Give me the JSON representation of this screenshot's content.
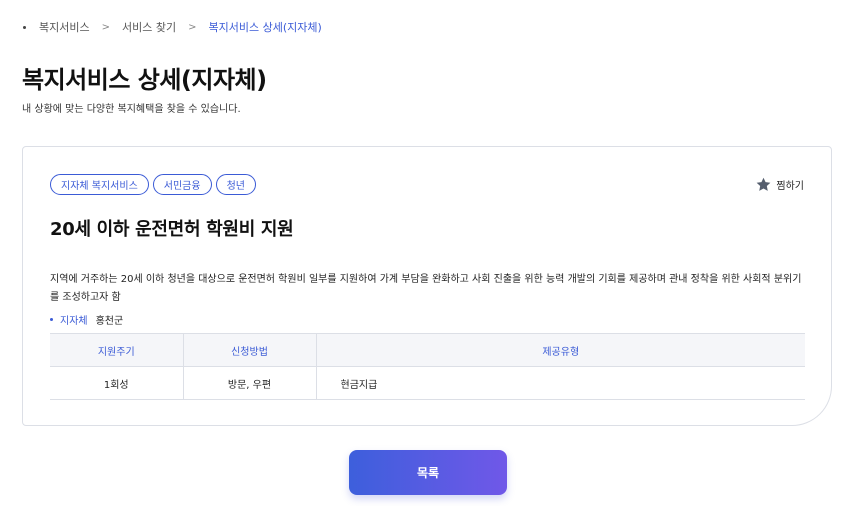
{
  "breadcrumb": {
    "items": [
      "복지서비스",
      "서비스 찾기",
      "복지서비스 상세(지자체)"
    ],
    "separator": ">"
  },
  "page": {
    "title": "복지서비스 상세(지자체)",
    "subtitle": "내 상황에 맞는 다양한 복지혜택을 찾을 수 있습니다."
  },
  "service": {
    "tags": [
      "지자체 복지서비스",
      "서민금융",
      "청년"
    ],
    "favorite_label": "찜하기",
    "favorite_icon": "star-icon",
    "title": "20세 이하 운전면허 학원비 지원",
    "description": "지역에 거주하는 20세 이하 청년을 대상으로 운전면허 학원비 일부를 지원하여 가계 부담을 완화하고 사회 진출을 위한 능력 개발의 기회를 제공하며 관내 정착을 위한 사회적 분위기를 조성하고자 함",
    "meta_label": "지자체",
    "meta_value": "홍천군",
    "table": {
      "headers": [
        "지원주기",
        "신청방법",
        "제공유형"
      ],
      "rows": [
        [
          "1회성",
          "방문, 우편",
          "현금지급"
        ]
      ]
    }
  },
  "actions": {
    "list_label": "목록"
  },
  "colors": {
    "accent": "#3b5bd6",
    "button_gradient_start": "#3d5fdc",
    "button_gradient_end": "#7058e8",
    "border": "#dcdfe6",
    "table_header_bg": "#f5f6f9"
  }
}
